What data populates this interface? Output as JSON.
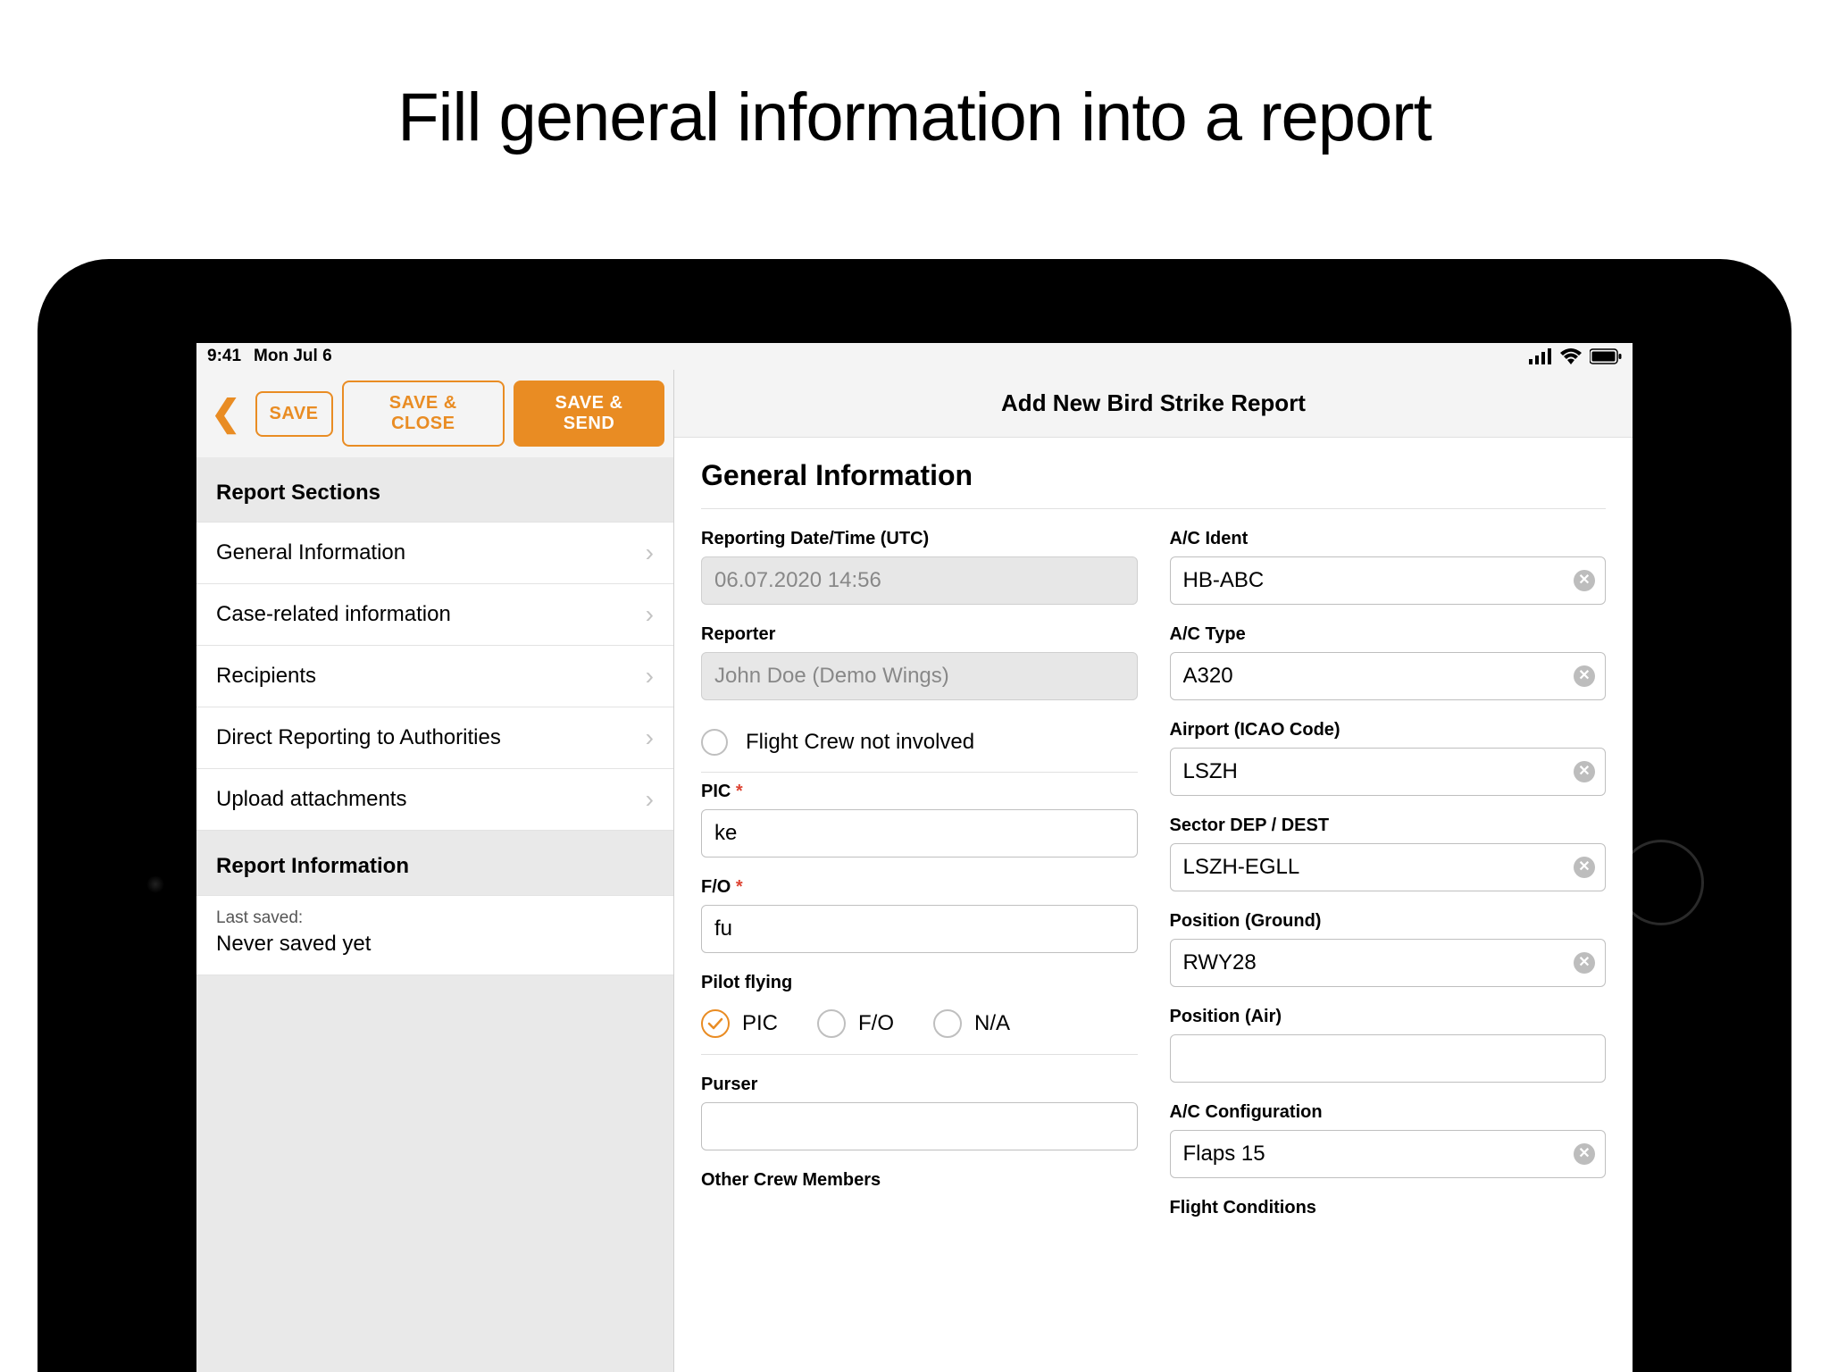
{
  "headline": "Fill general information into a report",
  "status": {
    "time": "9:41",
    "date": "Mon Jul 6"
  },
  "toolbar": {
    "save": "SAVE",
    "save_close": "SAVE & CLOSE",
    "save_send": "SAVE & SEND"
  },
  "sidebar": {
    "sections_header": "Report Sections",
    "items": [
      "General Information",
      "Case-related information",
      "Recipients",
      "Direct Reporting to Authorities",
      "Upload attachments"
    ],
    "info_header": "Report Information",
    "last_saved_label": "Last saved:",
    "last_saved_value": "Never saved yet"
  },
  "content": {
    "title": "Add New Bird Strike Report",
    "heading": "General Information",
    "left": {
      "reporting_date_label": "Reporting Date/Time (UTC)",
      "reporting_date_value": "06.07.2020 14:56",
      "reporter_label": "Reporter",
      "reporter_value": "John Doe (Demo Wings)",
      "flight_crew_not_involved": "Flight Crew not involved",
      "pic_label": "PIC",
      "pic_value": "ke",
      "fo_label": "F/O",
      "fo_value": "fu",
      "pilot_flying_label": "Pilot flying",
      "pilot_flying_options": [
        "PIC",
        "F/O",
        "N/A"
      ],
      "pilot_flying_selected": "PIC",
      "purser_label": "Purser",
      "purser_value": "",
      "other_crew_label": "Other Crew Members"
    },
    "right": {
      "ac_ident_label": "A/C Ident",
      "ac_ident_value": "HB-ABC",
      "ac_type_label": "A/C Type",
      "ac_type_value": "A320",
      "airport_label": "Airport (ICAO Code)",
      "airport_value": "LSZH",
      "sector_label": "Sector DEP / DEST",
      "sector_value": "LSZH-EGLL",
      "position_ground_label": "Position (Ground)",
      "position_ground_value": "RWY28",
      "position_air_label": "Position (Air)",
      "position_air_value": "",
      "ac_config_label": "A/C Configuration",
      "ac_config_value": "Flaps 15",
      "flight_conditions_label": "Flight Conditions"
    }
  }
}
